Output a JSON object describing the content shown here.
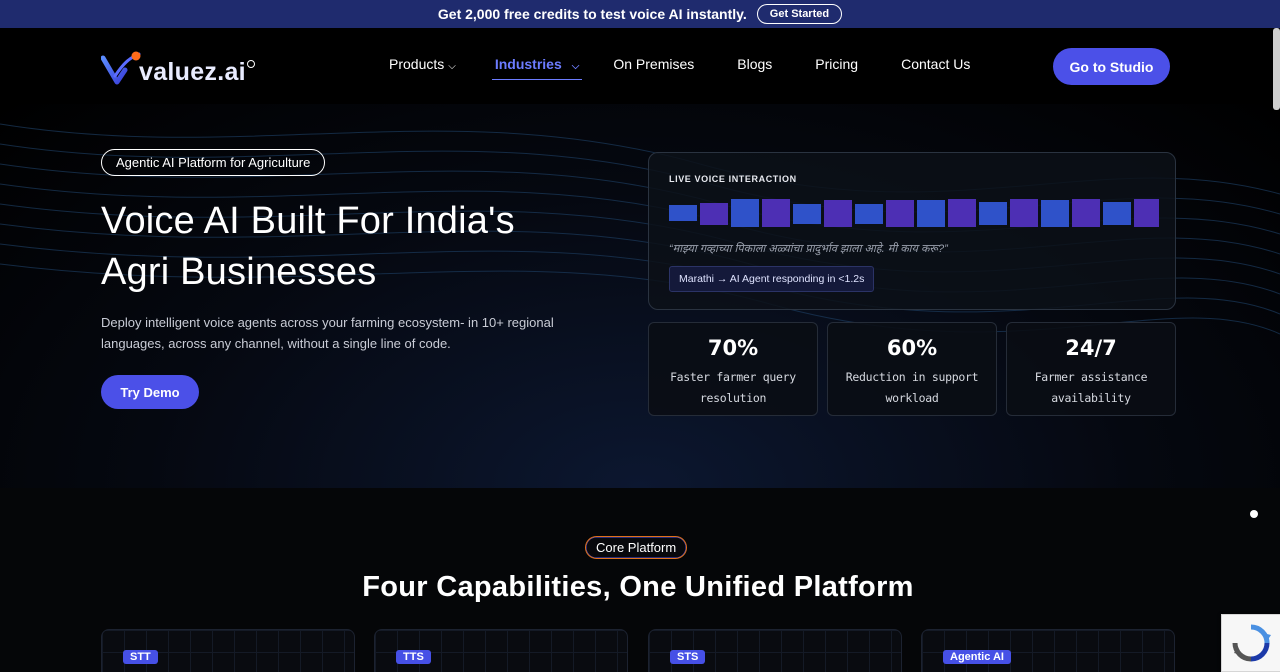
{
  "announcement": {
    "text": "Get 2,000 free credits to test voice AI instantly.",
    "button": "Get Started"
  },
  "brand": {
    "name": "valuez.ai",
    "mark_icon": "v-swoosh-logo-icon",
    "accent": "#4b50e8",
    "dot_color": "#ff6b1a"
  },
  "nav": {
    "items": [
      {
        "label": "Products",
        "dropdown": true,
        "active": false
      },
      {
        "label": "Industries",
        "dropdown": true,
        "active": true
      },
      {
        "label": "On Premises",
        "dropdown": false,
        "active": false
      },
      {
        "label": "Blogs",
        "dropdown": false,
        "active": false
      },
      {
        "label": "Pricing",
        "dropdown": false,
        "active": false
      },
      {
        "label": "Contact Us",
        "dropdown": false,
        "active": false
      }
    ],
    "cta": "Go to Studio"
  },
  "hero": {
    "badge": "Agentic AI Platform for Agriculture",
    "title_line1": "Voice AI Built For India's",
    "title_line2": "Agri Businesses",
    "description": "Deploy intelligent voice agents across your farming ecosystem- in 10+ regional languages, across any channel, without a single line of code.",
    "cta": "Try Demo"
  },
  "live": {
    "title": "LIVE VOICE INTERACTION",
    "quote": "“माझ्या गव्हाच्या पिकाला अळ्यांचा प्रादुर्भाव झाला आहे. मी काय करू?”",
    "tag": "Marathi → AI Agent responding in <1.2s",
    "bar_colors": [
      "#2f52c9",
      "#4d2fb4"
    ]
  },
  "stats": [
    {
      "value": "70%",
      "label": "Faster farmer query resolution"
    },
    {
      "value": "60%",
      "label": "Reduction in support workload"
    },
    {
      "value": "24/7",
      "label": "Farmer assistance availability"
    }
  ],
  "core": {
    "badge": "Core Platform",
    "title": "Four Capabilities, One Unified Platform",
    "cards": [
      {
        "tag": "STT"
      },
      {
        "tag": "TTS"
      },
      {
        "tag": "STS"
      },
      {
        "tag": "Agentic AI"
      }
    ]
  },
  "widgets": {
    "recaptcha_icon": "recaptcha-icon"
  }
}
